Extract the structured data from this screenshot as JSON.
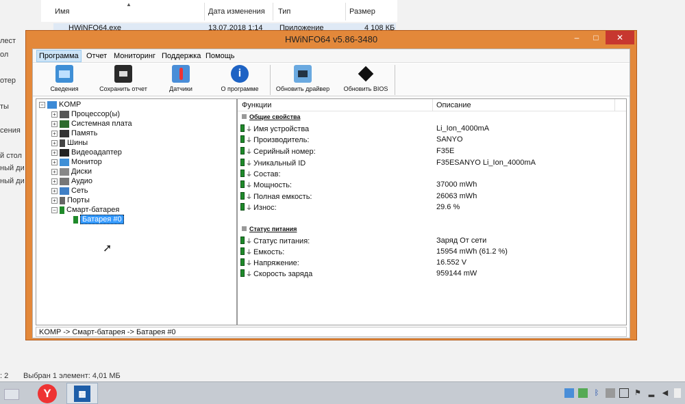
{
  "explorer": {
    "columns": {
      "name": "Имя",
      "date": "Дата изменения",
      "type": "Тип",
      "size": "Размер"
    },
    "file": {
      "name": "HWiNFO64.exe",
      "date": "13.07.2018 1:14",
      "type": "Приложение",
      "size": "4 108 КБ"
    },
    "left_fragments": [
      "лест",
      "ол",
      "отер",
      "ты",
      "сения",
      "й стол",
      "ный ди",
      "ный ди"
    ],
    "status": {
      "count": ": 2",
      "selected": "Выбран 1 элемент: 4,01 МБ"
    }
  },
  "window": {
    "title": "HWiNFO64 v5.86-3480",
    "min_glyph": "–",
    "max_glyph": "□",
    "close_glyph": "✕",
    "menu": [
      "Программа",
      "Отчет",
      "Мониторинг",
      "Поддержка",
      "Помощь"
    ],
    "toolbar": [
      {
        "label": "Сведения",
        "icon": "monitor-icon"
      },
      {
        "label": "Сохранить отчет",
        "icon": "floppy-icon"
      },
      {
        "label": "Датчики",
        "icon": "thermometer-icon"
      },
      {
        "label": "О программе",
        "icon": "info-icon"
      },
      {
        "label": "Обновить драйвер",
        "icon": "driver-update-icon"
      },
      {
        "label": "Обновить BIOS",
        "icon": "bios-chip-icon"
      }
    ],
    "tree": {
      "root": "KOMP",
      "items": [
        "Процессор(ы)",
        "Системная плата",
        "Память",
        "Шины",
        "Видеоадаптер",
        "Монитор",
        "Диски",
        "Аудио",
        "Сеть",
        "Порты",
        "Смарт-батарея"
      ],
      "selected_child": "Батарея #0"
    },
    "panel": {
      "col_functions": "Функции",
      "col_description": "Описание",
      "section1": "Общие свойства",
      "rows1": [
        {
          "k": "Имя устройства",
          "v": "Li_Ion_4000mA"
        },
        {
          "k": "Производитель:",
          "v": "SANYO"
        },
        {
          "k": "Серийный номер:",
          "v": "F35E"
        },
        {
          "k": "Уникальный ID",
          "v": "F35ESANYO Li_Ion_4000mA"
        },
        {
          "k": "Состав:",
          "v": ""
        },
        {
          "k": "Мощность:",
          "v": "37000 mWh"
        },
        {
          "k": "Полная емкость:",
          "v": "26063 mWh"
        },
        {
          "k": "Износ:",
          "v": "29.6 %"
        }
      ],
      "section2": "Статус питания",
      "rows2": [
        {
          "k": "Статус питания:",
          "v": "Заряд От сети"
        },
        {
          "k": "Емкость:",
          "v": "15954 mWh (61.2 %)"
        },
        {
          "k": "Напряжение:",
          "v": "16.552 V"
        },
        {
          "k": "Скорость заряда",
          "v": "959144 mW"
        }
      ]
    },
    "statusline": "KOMP -> Смарт-батарея -> Батарея #0"
  },
  "taskbar": {
    "yandex_glyph": "Y",
    "hwinfo_glyph": "▦"
  }
}
